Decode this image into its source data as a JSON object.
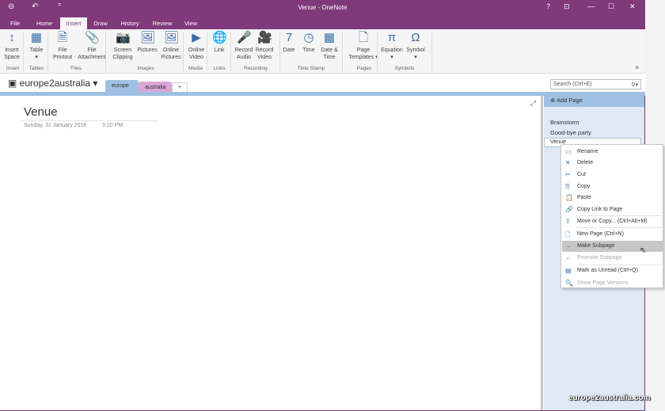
{
  "window": {
    "title": "Venue - OneNote",
    "help": "?",
    "qat_more": "="
  },
  "tabs": [
    "File",
    "Home",
    "Insert",
    "Draw",
    "History",
    "Review",
    "View"
  ],
  "ribbon": {
    "buttons": [
      {
        "l1": "Insert",
        "l2": "Space",
        "icon": "↕"
      },
      {
        "l1": "Table",
        "l2": "▾",
        "icon": "▦"
      },
      {
        "l1": "File",
        "l2": "Printout",
        "icon": "🗎"
      },
      {
        "l1": "File",
        "l2": "Attachment",
        "icon": "📎"
      },
      {
        "l1": "Screen",
        "l2": "Clipping",
        "icon": "📷"
      },
      {
        "l1": "Pictures",
        "l2": "",
        "icon": "🖼"
      },
      {
        "l1": "Online",
        "l2": "Pictures",
        "icon": "🖼"
      },
      {
        "l1": "Online",
        "l2": "Video",
        "icon": "▶"
      },
      {
        "l1": "Link",
        "l2": "",
        "icon": "🌐"
      },
      {
        "l1": "Record",
        "l2": "Audio",
        "icon": "🎤"
      },
      {
        "l1": "Record",
        "l2": "Video",
        "icon": "🎥"
      },
      {
        "l1": "Date",
        "l2": "",
        "icon": "7"
      },
      {
        "l1": "Time",
        "l2": "",
        "icon": "◷"
      },
      {
        "l1": "Date &",
        "l2": "Time",
        "icon": "▦"
      },
      {
        "l1": "Page",
        "l2": "Templates ▾",
        "icon": "🗋"
      },
      {
        "l1": "Equation",
        "l2": "▾",
        "icon": "π"
      },
      {
        "l1": "Symbol",
        "l2": "▾",
        "icon": "Ω"
      }
    ],
    "groups": [
      "Insert",
      "Tables",
      "Files",
      "Images",
      "Media",
      "Links",
      "Recording",
      "Time Stamp",
      "Pages",
      "Symbols"
    ]
  },
  "notebook": {
    "name": "europe2australia",
    "sections": [
      "europe",
      "australia",
      "+"
    ]
  },
  "search": {
    "placeholder": "Search (Ctrl+E)"
  },
  "page": {
    "title": "Venue",
    "date": "Sunday, 31 January 2016",
    "time": "3:20 PM"
  },
  "pages_panel": {
    "add_page": "Add Page",
    "pages": [
      "Brainstorm",
      "Good-bye party",
      "Venue"
    ]
  },
  "context_menu": [
    {
      "label": "Rename",
      "icon": "▭"
    },
    {
      "label": "Delete",
      "icon": "✕"
    },
    {
      "label": "Cut",
      "icon": "✂"
    },
    {
      "label": "Copy",
      "icon": "⎘"
    },
    {
      "label": "Paste",
      "icon": "📋"
    },
    {
      "label": "Copy Link to Page",
      "icon": "🔗"
    },
    {
      "label": "Move or Copy...  (Ctrl+Alt+M)",
      "icon": "⇪"
    },
    {
      "label": "New Page  (Ctrl+N)",
      "icon": "🗋"
    },
    {
      "label": "Make Subpage",
      "icon": "→"
    },
    {
      "label": "Promote Subpage",
      "icon": "←"
    },
    {
      "label": "Mark as Unread  (Ctrl+Q)",
      "icon": "▤"
    },
    {
      "label": "Show Page Versions",
      "icon": "🔍"
    }
  ],
  "watermark": "europe2australia.com"
}
